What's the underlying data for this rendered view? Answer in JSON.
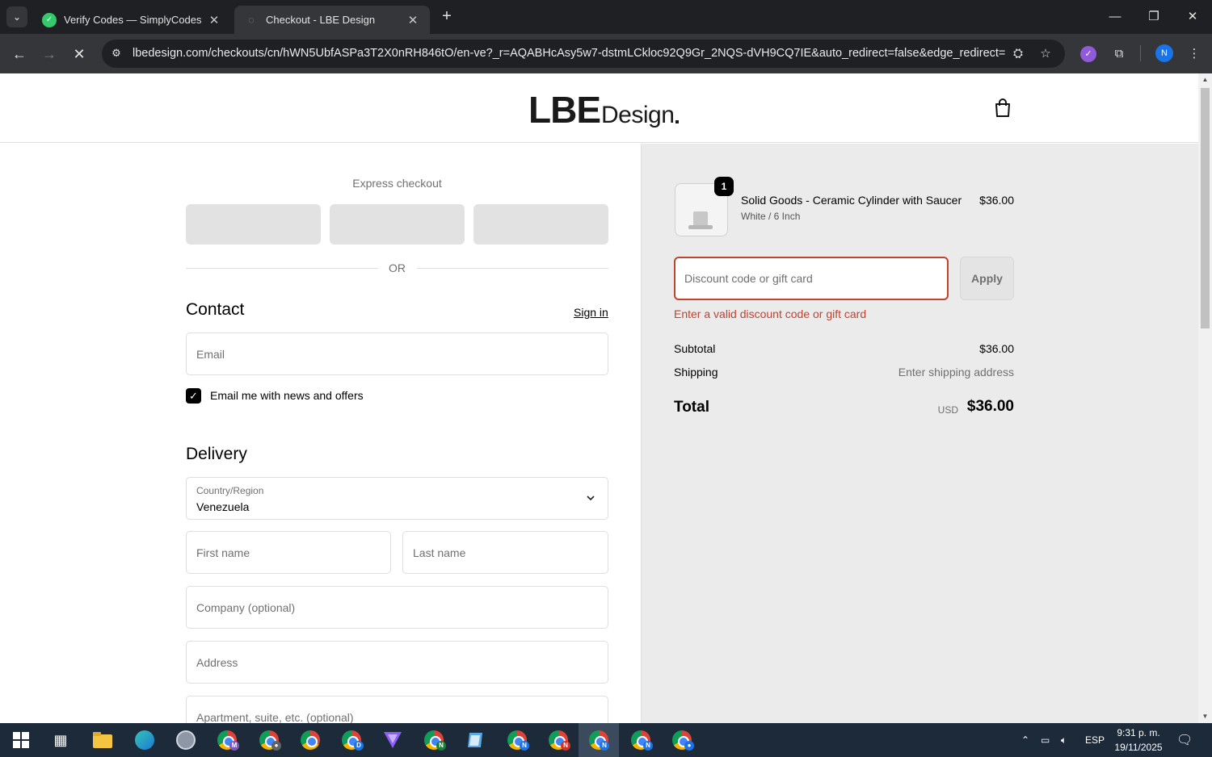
{
  "browser": {
    "tabs": [
      {
        "title": "Verify Codes — SimplyCodes",
        "active": false
      },
      {
        "title": "Checkout - LBE Design",
        "active": true
      }
    ],
    "url": "lbedesign.com/checkouts/cn/hWN5UbfASPa3T2X0nRH846tO/en-ve?_r=AQABHcAsy5w7-dstmLCkloc92Q9Gr_2NQS-dVH9CQ7IE&auto_redirect=false&edge_redirect=...",
    "profile_initial": "N"
  },
  "header": {
    "logo_main": "LBE",
    "logo_sub": "Design"
  },
  "checkout": {
    "express_label": "Express checkout",
    "or_label": "OR",
    "contact": {
      "title": "Contact",
      "sign_in": "Sign in",
      "email_placeholder": "Email",
      "newsletter_label": "Email me with news and offers",
      "newsletter_checked": true
    },
    "delivery": {
      "title": "Delivery",
      "country_label": "Country/Region",
      "country_value": "Venezuela",
      "first_name_placeholder": "First name",
      "last_name_placeholder": "Last name",
      "company_placeholder": "Company (optional)",
      "address_placeholder": "Address",
      "apartment_placeholder": "Apartment, suite, etc. (optional)"
    }
  },
  "summary": {
    "item": {
      "quantity": "1",
      "name": "Solid Goods - Ceramic Cylinder with Saucer",
      "variant": "White / 6 Inch",
      "price": "$36.00"
    },
    "discount_placeholder": "Discount code or gift card",
    "apply_label": "Apply",
    "discount_error": "Enter a valid discount code or gift card",
    "subtotal_label": "Subtotal",
    "subtotal_value": "$36.00",
    "shipping_label": "Shipping",
    "shipping_value": "Enter shipping address",
    "total_label": "Total",
    "total_currency": "USD",
    "total_value": "$36.00",
    "error_color": "#c0432e"
  },
  "taskbar": {
    "language": "ESP",
    "time": "9:31 p. m.",
    "date": "19/11/2025"
  }
}
